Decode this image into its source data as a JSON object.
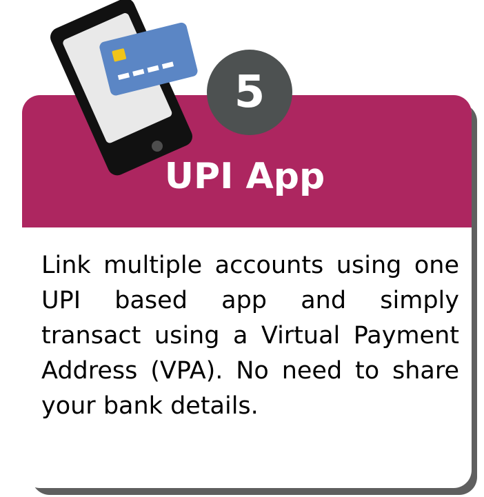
{
  "step": {
    "number": "5"
  },
  "card": {
    "title": "UPI App",
    "description": "Link multiple accounts using one UPI based app and simply transact using a Virtual Pay­ment Address (VPA). No need to share your bank details."
  },
  "colors": {
    "header": "#ad2660",
    "badge": "#4d5151",
    "card_shadow": "#5f5f5f",
    "phone_body": "#111111",
    "phone_screen": "#e9e9e9",
    "credit_card": "#5b86c5",
    "card_chip": "#f0c419"
  },
  "icons": {
    "phone": "smartphone-icon",
    "card": "credit-card-icon"
  }
}
